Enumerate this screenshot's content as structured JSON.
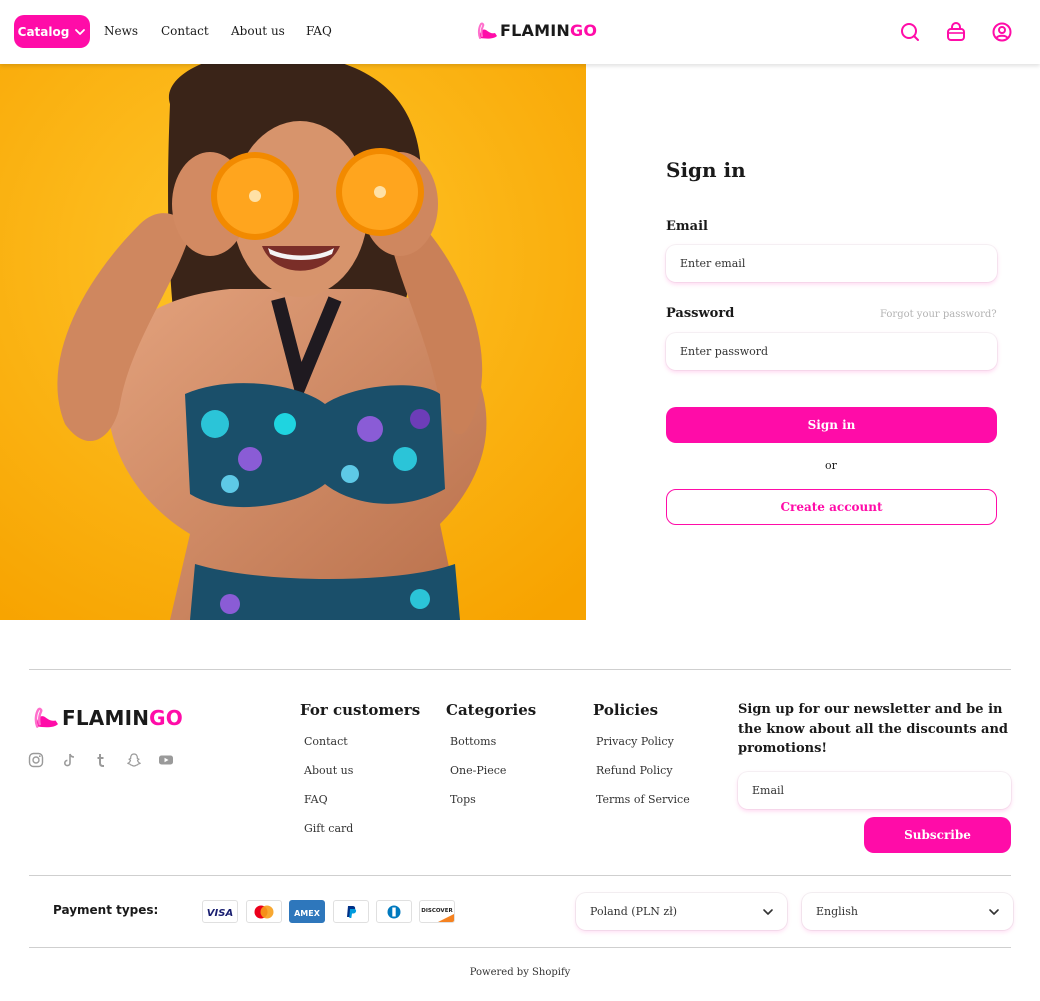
{
  "header": {
    "catalog_label": "Catalog",
    "nav": [
      "News",
      "Contact",
      "About us",
      "FAQ"
    ],
    "logo_dark": "FLAMIN",
    "logo_pink": "GO",
    "icons": [
      "search-icon",
      "bag-icon",
      "account-icon"
    ]
  },
  "hero": {
    "image": "woman in swimsuit holding orange halves over eyes on yellow background"
  },
  "signin": {
    "title": "Sign in",
    "email_label": "Email",
    "email_placeholder": "Enter email",
    "password_label": "Password",
    "forgot": "Forgot your password?",
    "password_placeholder": "Enter password",
    "submit": "Sign in",
    "or": "or",
    "create": "Create account"
  },
  "footer": {
    "logo_dark": "FLAMIN",
    "logo_pink": "GO",
    "social": [
      "instagram-icon",
      "tiktok-icon",
      "tumblr-icon",
      "snapchat-icon",
      "youtube-icon"
    ],
    "columns": [
      {
        "title": "For customers",
        "links": [
          "Contact",
          "About us",
          "FAQ",
          "Gift card"
        ]
      },
      {
        "title": "Categories",
        "links": [
          "Bottoms",
          "One-Piece",
          "Tops"
        ]
      },
      {
        "title": "Policies",
        "links": [
          "Privacy Policy",
          "Refund Policy",
          "Terms of Service"
        ]
      }
    ],
    "newsletter_text": "Sign up for our newsletter and be in the know about all the discounts and promotions!",
    "newsletter_placeholder": "Email",
    "subscribe": "Subscribe",
    "payment_label": "Payment types:",
    "payment_methods": [
      "VISA",
      "Mastercard",
      "AMEX",
      "PayPal",
      "Diners Club",
      "DISCOVER"
    ],
    "country": "Poland (PLN zł)",
    "language": "English",
    "powered": "Powered by Shopify"
  },
  "colors": {
    "accent": "#ff0ca8",
    "hero_bg": "#ffb20a"
  }
}
